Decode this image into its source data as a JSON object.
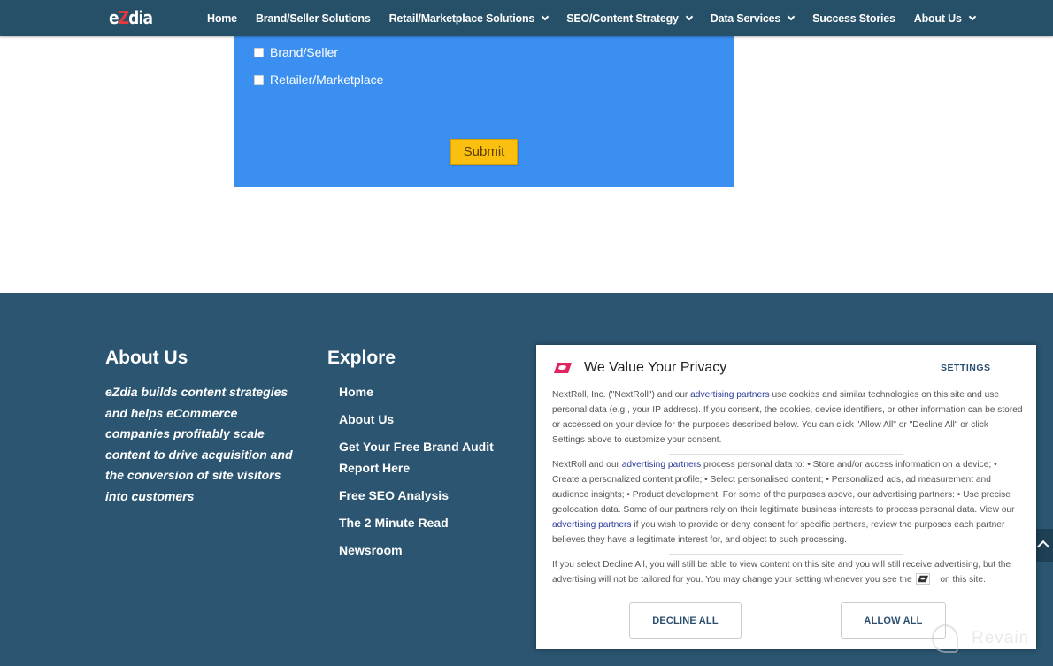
{
  "header": {
    "logo_prefix": "e",
    "logo_z": "Z",
    "logo_suffix": "dia",
    "nav": [
      {
        "label": "Home",
        "dropdown": false
      },
      {
        "label": "Brand/Seller Solutions",
        "dropdown": false
      },
      {
        "label": "Retail/Marketplace Solutions",
        "dropdown": true
      },
      {
        "label": "SEO/Content Strategy",
        "dropdown": true
      },
      {
        "label": "Data Services",
        "dropdown": true
      },
      {
        "label": "Success Stories",
        "dropdown": false
      },
      {
        "label": "About Us",
        "dropdown": true
      }
    ]
  },
  "form": {
    "checkboxes": [
      {
        "label": "Brand/Seller",
        "checked": false
      },
      {
        "label": "Retailer/Marketplace",
        "checked": false
      }
    ],
    "submit_label": "Submit",
    "panel_color": "#3a8ff0",
    "submit_color": "#fbbf0f"
  },
  "footer": {
    "about": {
      "heading": "About Us",
      "text": "eZdia builds content strategies and helps eCommerce companies profitably scale content to drive acquisition and the conversion of site visitors into customers"
    },
    "explore": {
      "heading": "Explore",
      "links": [
        "Home",
        "About Us",
        "Get Your Free Brand Audit Report Here",
        "Free SEO Analysis",
        "The 2 Minute Read",
        "Newsroom"
      ]
    },
    "bg_color": "#2b5570"
  },
  "privacy": {
    "title": "We Value Your Privacy",
    "settings_label": "SETTINGS",
    "p1_a": "NextRoll, Inc. (\"NextRoll\") and our ",
    "p1_link": "advertising partners",
    "p1_b": " use cookies and similar technologies on this site and use personal data (e.g., your IP address). If you consent, the cookies, device identifiers, or other information can be stored or accessed on your device for the purposes described below. You can click \"Allow All\" or \"Decline All\" or click Settings above to customize your consent.",
    "p2_a": "NextRoll and our ",
    "p2_link1": "advertising partners",
    "p2_b": " process personal data to: • Store and/or access information on a device; • Create a personalized content profile; • Select personalised content; • Personalized ads, ad measurement and audience insights; • Product development. For some of the purposes above, our advertising partners: • Use precise geolocation data. Some of our partners rely on their legitimate business interests to process personal data. View our ",
    "p2_link2": "advertising partners",
    "p2_c": " if you wish to provide or deny consent for specific partners, review the purposes each partner believes they have a legitimate interest for, and object to such processing.",
    "p3_a": "If you select Decline All, you will still be able to view content on this site and you will still receive advertising, but the advertising will not be tailored for you. You may change your setting whenever you see the",
    "p3_b": "on this site.",
    "decline_label": "DECLINE ALL",
    "allow_label": "ALLOW ALL",
    "brand_color": "#e0245e"
  },
  "watermark": {
    "text": "Revain"
  }
}
